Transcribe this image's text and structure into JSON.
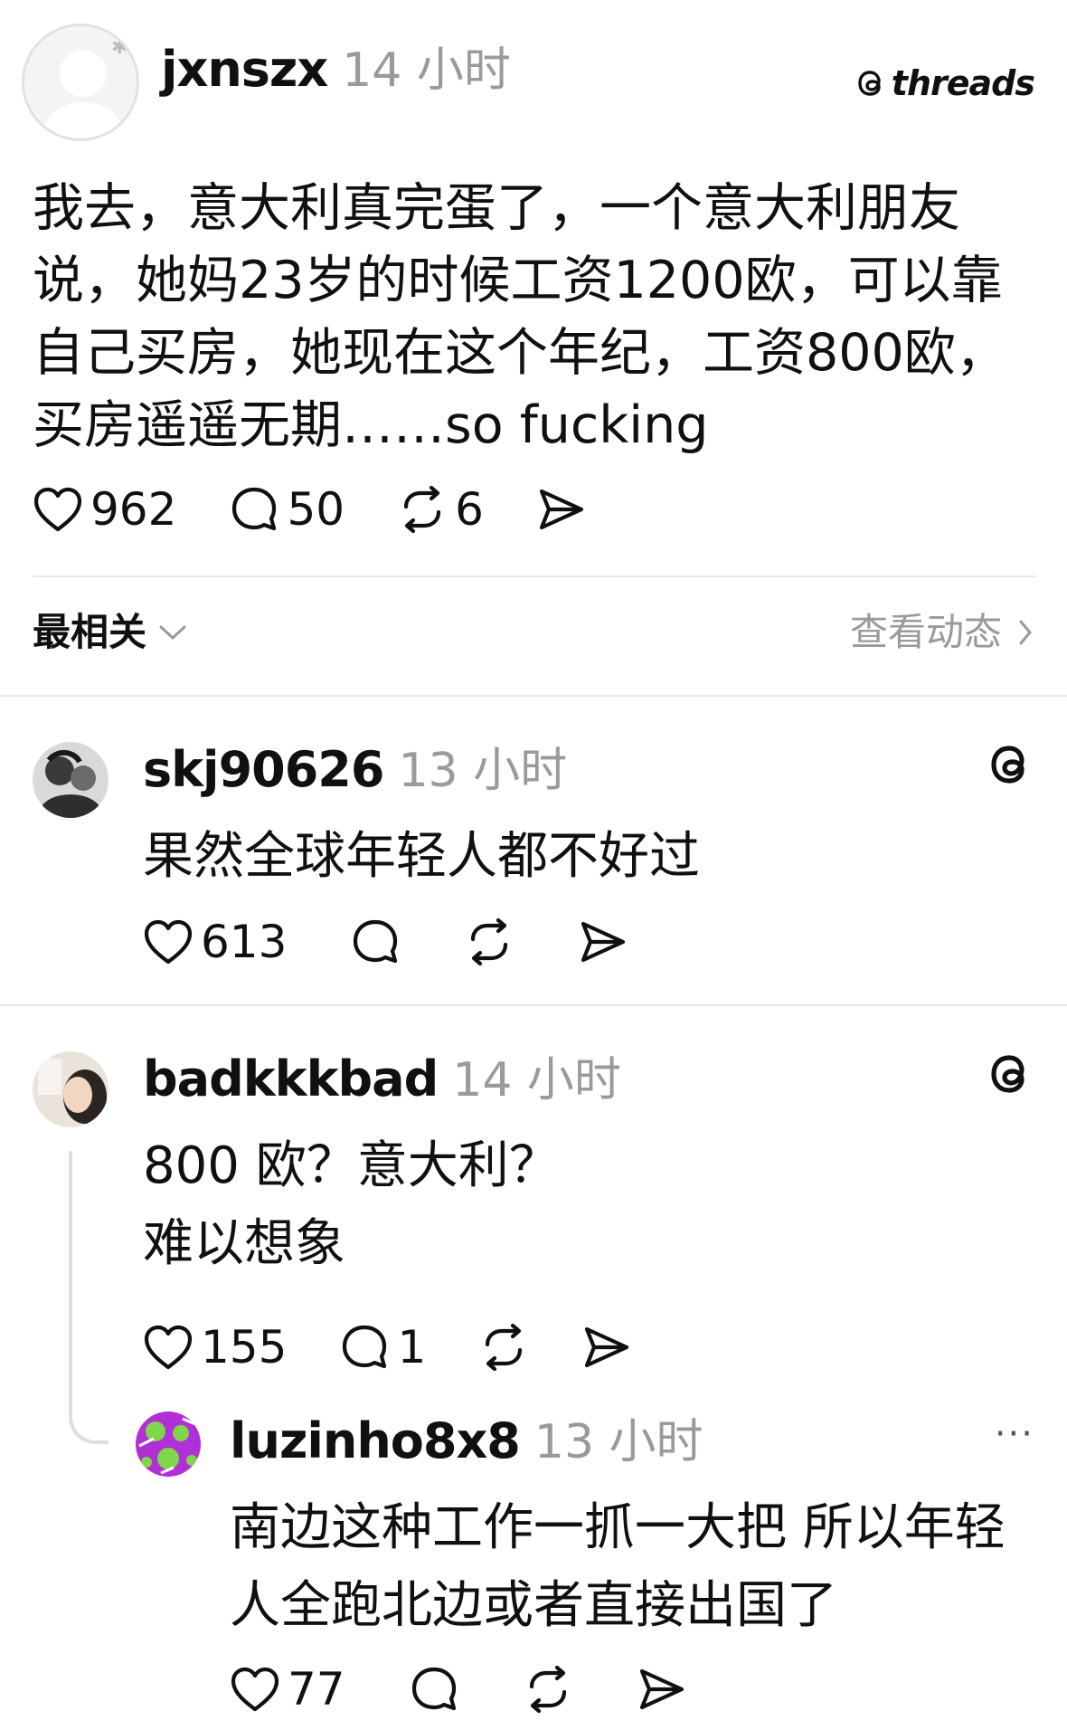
{
  "post": {
    "username": "jxnszx",
    "time": "14 小时",
    "brand": "threads",
    "body": "我去，意大利真完蛋了，一个意大利朋友说，她妈23岁的时候工资1200欧，可以靠自己买房，她现在这个年纪，工资800欧，买房遥遥无期……so fucking",
    "likes": "962",
    "replies": "50",
    "reposts": "6"
  },
  "sort": {
    "label": "最相关",
    "activity_link": "查看动态"
  },
  "comments": [
    {
      "username": "skj90626",
      "time": "13 小时",
      "text": "果然全球年轻人都不好过",
      "likes": "613",
      "replies": "",
      "reposts": ""
    },
    {
      "username": "badkkkbad",
      "time": "14 小时",
      "text_line1": "800 欧？意大利？",
      "text_line2": "难以想象",
      "likes": "155",
      "replies": "1",
      "reposts": ""
    }
  ],
  "reply": {
    "username": "luzinho8x8",
    "time": "13 小时",
    "text": "南边这种工作一抓一大把 所以年轻人全跑北边或者直接出国了",
    "likes": "77",
    "more": "···"
  },
  "colors": {
    "text": "#101010",
    "muted": "#9a9a9a",
    "divider": "#e6e6e6",
    "reply_avatar_bg": "#b12fd6",
    "reply_avatar_fg": "#7fd64a"
  }
}
